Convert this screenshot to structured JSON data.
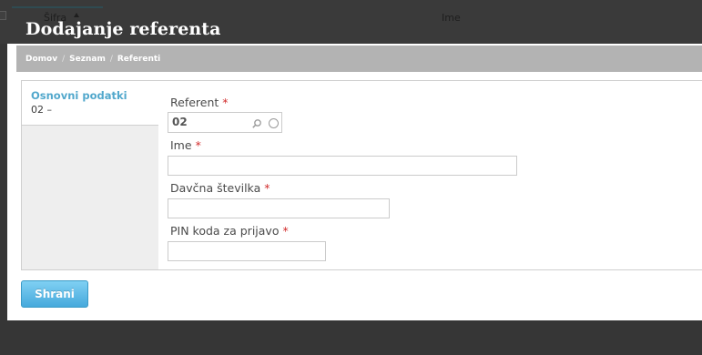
{
  "background_table": {
    "columns": [
      "Šifra",
      "Ime"
    ]
  },
  "modal": {
    "title": "Dodajanje referenta",
    "breadcrumb": [
      "Domov",
      "Seznam",
      "Referenti"
    ],
    "side_tab": {
      "title": "Osnovni podatki",
      "subtitle": "02 –"
    },
    "fields": {
      "referent": {
        "label": "Referent",
        "value": "02"
      },
      "ime": {
        "label": "Ime",
        "value": ""
      },
      "davcna": {
        "label": "Davčna številka",
        "value": ""
      },
      "pin": {
        "label": "PIN koda za prijavo",
        "value": ""
      }
    },
    "required_mark": "*",
    "save_label": "Shrani"
  },
  "colors": {
    "accent": "#52a8cc",
    "required": "#d22c2c",
    "button_top": "#7fd0f3",
    "button_bottom": "#46a9dc"
  },
  "icons": [
    "search-icon",
    "clear-icon",
    "sort-ascending-icon"
  ]
}
